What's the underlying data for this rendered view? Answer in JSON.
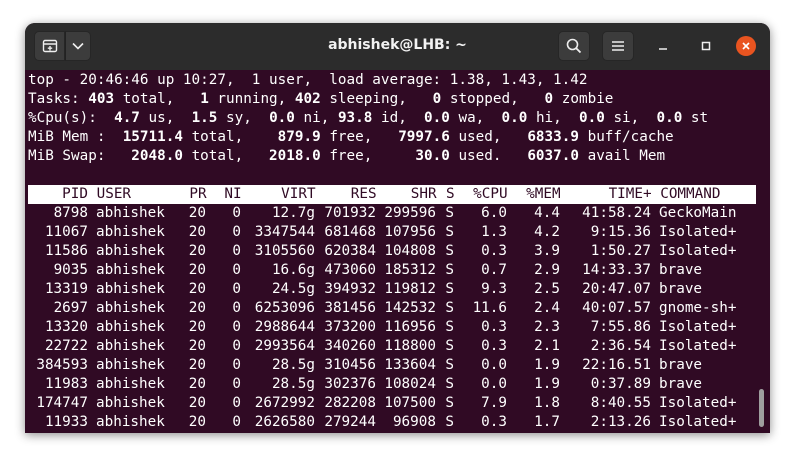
{
  "window": {
    "title": "abhishek@LHB: ~"
  },
  "summary": {
    "line1": "top - 20:46:46 up 10:27,  1 user,  load average: 1.38, 1.43, 1.42",
    "tasks": {
      "label": "Tasks:",
      "total": "403",
      "total_label": "total,",
      "running": "1",
      "running_label": "running,",
      "sleeping": "402",
      "sleeping_label": "sleeping,",
      "stopped": "0",
      "stopped_label": "stopped,",
      "zombie": "0",
      "zombie_label": "zombie"
    },
    "cpu": {
      "label": "%Cpu(s):",
      "us": "4.7",
      "us_label": "us,",
      "sy": "1.5",
      "sy_label": "sy,",
      "ni": "0.0",
      "ni_label": "ni,",
      "id": "93.8",
      "id_label": "id,",
      "wa": "0.0",
      "wa_label": "wa,",
      "hi": "0.0",
      "hi_label": "hi,",
      "si": "0.0",
      "si_label": "si,",
      "st": "0.0",
      "st_label": "st"
    },
    "mem": {
      "label": "MiB Mem :",
      "total": "15711.4",
      "total_label": "total,",
      "free": "879.9",
      "free_label": "free,",
      "used": "7997.6",
      "used_label": "used,",
      "buff": "6833.9",
      "buff_label": "buff/cache"
    },
    "swap": {
      "label": "MiB Swap:",
      "total": "2048.0",
      "total_label": "total,",
      "free": "2018.0",
      "free_label": "free,",
      "used": "30.0",
      "used_label": "used.",
      "avail": "6037.0",
      "avail_label": "avail Mem"
    }
  },
  "columns": [
    "PID",
    "USER",
    "PR",
    "NI",
    "VIRT",
    "RES",
    "SHR",
    "S",
    "%CPU",
    "%MEM",
    "TIME+",
    "COMMAND"
  ],
  "processes": [
    [
      "8798",
      "abhishek",
      "20",
      "0",
      "12.7g",
      "701932",
      "299596",
      "S",
      "6.0",
      "4.4",
      "41:58.24",
      "GeckoMain"
    ],
    [
      "11067",
      "abhishek",
      "20",
      "0",
      "3347544",
      "681468",
      "107956",
      "S",
      "1.3",
      "4.2",
      "9:15.36",
      "Isolated+"
    ],
    [
      "11586",
      "abhishek",
      "20",
      "0",
      "3105560",
      "620384",
      "104808",
      "S",
      "0.3",
      "3.9",
      "1:50.27",
      "Isolated+"
    ],
    [
      "9035",
      "abhishek",
      "20",
      "0",
      "16.6g",
      "473060",
      "185312",
      "S",
      "0.7",
      "2.9",
      "14:33.37",
      "brave"
    ],
    [
      "13319",
      "abhishek",
      "20",
      "0",
      "24.5g",
      "394932",
      "119812",
      "S",
      "9.3",
      "2.5",
      "20:47.07",
      "brave"
    ],
    [
      "2697",
      "abhishek",
      "20",
      "0",
      "6253096",
      "381456",
      "142532",
      "S",
      "11.6",
      "2.4",
      "40:07.57",
      "gnome-sh+"
    ],
    [
      "13320",
      "abhishek",
      "20",
      "0",
      "2988644",
      "373200",
      "116956",
      "S",
      "0.3",
      "2.3",
      "7:55.86",
      "Isolated+"
    ],
    [
      "22722",
      "abhishek",
      "20",
      "0",
      "2993564",
      "340260",
      "118800",
      "S",
      "0.3",
      "2.1",
      "2:36.54",
      "Isolated+"
    ],
    [
      "384593",
      "abhishek",
      "20",
      "0",
      "28.5g",
      "310456",
      "133604",
      "S",
      "0.0",
      "1.9",
      "22:16.51",
      "brave"
    ],
    [
      "11983",
      "abhishek",
      "20",
      "0",
      "28.5g",
      "302376",
      "108024",
      "S",
      "0.0",
      "1.9",
      "0:37.89",
      "brave"
    ],
    [
      "174747",
      "abhishek",
      "20",
      "0",
      "2672992",
      "282208",
      "107500",
      "S",
      "7.9",
      "1.8",
      "8:40.55",
      "Isolated+"
    ],
    [
      "11933",
      "abhishek",
      "20",
      "0",
      "2626580",
      "279244",
      "96908",
      "S",
      "0.3",
      "1.7",
      "2:13.26",
      "Isolated+"
    ]
  ],
  "icons": {
    "new_tab": "new-tab-icon",
    "dropdown": "chevron-down-icon",
    "search": "search-icon",
    "menu": "hamburger-menu-icon",
    "minimize": "minimize-icon",
    "maximize": "maximize-icon",
    "close": "close-icon"
  },
  "colors": {
    "terminal_bg": "#300a24",
    "titlebar_bg": "#2c2c2c",
    "close_button": "#e95420",
    "text": "#ffffff"
  }
}
